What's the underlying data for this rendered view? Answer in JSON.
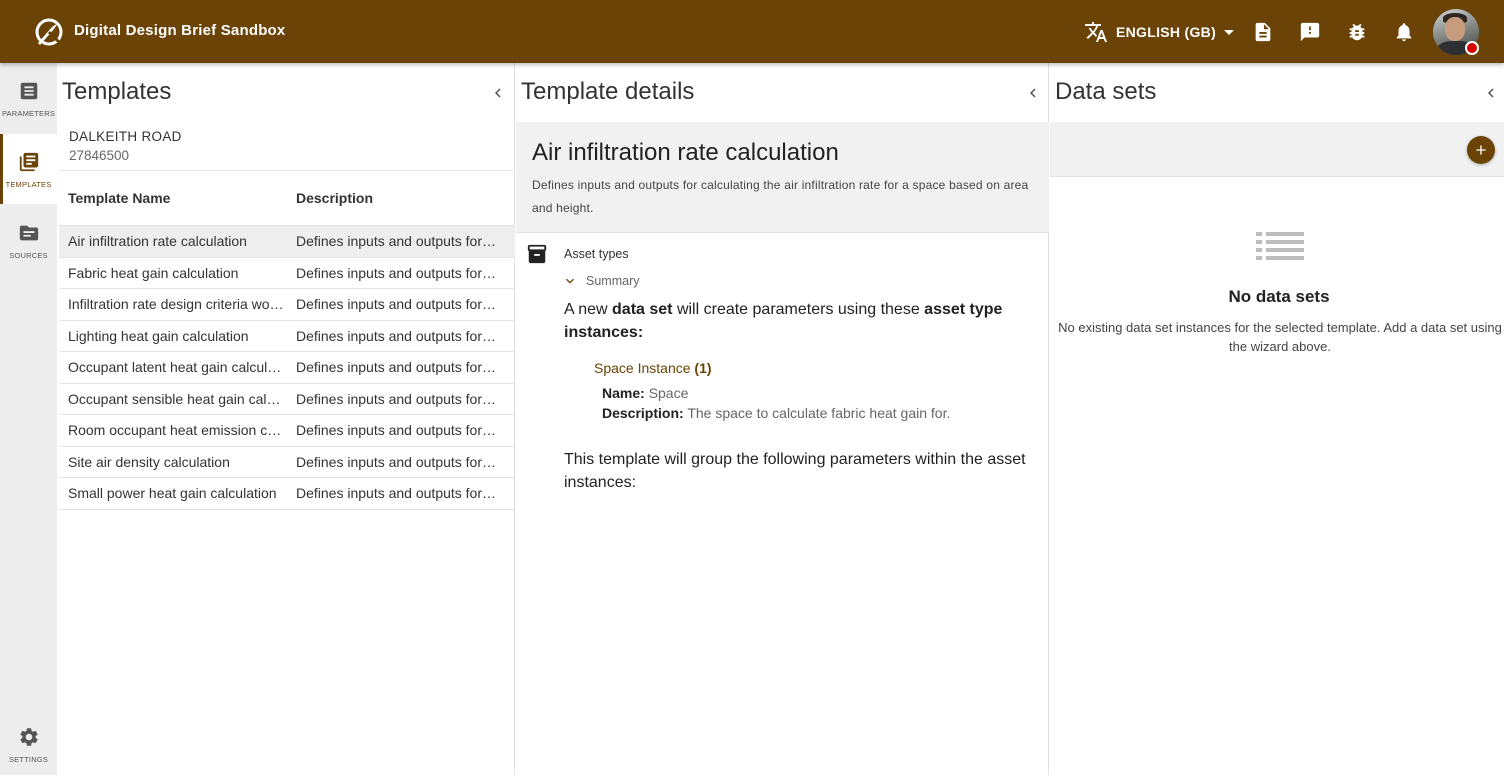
{
  "app": {
    "title": "Digital Design Brief Sandbox",
    "language": "ENGLISH (GB)",
    "accent_color": "#6b4306"
  },
  "toolbar_icons": [
    "translate-icon",
    "document-icon",
    "feedback-icon",
    "bug-icon",
    "bell-icon"
  ],
  "rail": {
    "items": [
      {
        "label": "PARAMETERS",
        "icon": "list-icon"
      },
      {
        "label": "TEMPLATES",
        "icon": "library-icon",
        "active": true
      },
      {
        "label": "SOURCES",
        "icon": "folder-icon"
      },
      {
        "label": "SETTINGS",
        "icon": "gear-icon"
      }
    ]
  },
  "templates": {
    "title": "Templates",
    "project_name": "DALKEITH ROAD",
    "project_number": "27846500",
    "columns": [
      "Template Name",
      "Description"
    ],
    "rows": [
      {
        "name": "Air infiltration rate calculation",
        "description": "Defines inputs and outputs for calculating the air infiltration rate"
      },
      {
        "name": "Fabric heat gain calculation",
        "description": "Defines inputs and outputs for calculating fabric heat gain"
      },
      {
        "name": "Infiltration rate design criteria workflow",
        "description": "Defines inputs and outputs for infiltration rate design criteria"
      },
      {
        "name": "Lighting heat gain calculation",
        "description": "Defines inputs and outputs for calculating lighting heat gain"
      },
      {
        "name": "Occupant latent heat gain calculation",
        "description": "Defines inputs and outputs for calculating occupant latent heat gain"
      },
      {
        "name": "Occupant sensible heat gain calculation",
        "description": "Defines inputs and outputs for calculating occupant sensible heat gain"
      },
      {
        "name": "Room occupant heat emission calculation",
        "description": "Defines inputs and outputs for room occupant heat emission"
      },
      {
        "name": "Site air density calculation",
        "description": "Defines inputs and outputs for calculating site air density"
      },
      {
        "name": "Small power heat gain calculation",
        "description": "Defines inputs and outputs for calculating small power heat gain"
      }
    ]
  },
  "details": {
    "title": "Template details",
    "template_title": "Air infiltration rate calculation",
    "template_description": "Defines inputs and outputs for calculating the air infiltration rate for a space based on area and height.",
    "asset_types_label": "Asset types",
    "summary_label": "Summary",
    "para1_a": "A new ",
    "para1_b": "data set",
    "para1_c": " will create parameters using these ",
    "para1_d": "asset type instances:",
    "instance_name": "Space Instance",
    "instance_count": "(1)",
    "name_key": "Name:",
    "name_value": "Space",
    "desc_key": "Description:",
    "desc_value": "The space to calculate fabric heat gain for.",
    "para2": "This template will group the following parameters within the asset instances:"
  },
  "datasets": {
    "title": "Data sets",
    "empty_title": "No data sets",
    "empty_description": "No existing data set instances for the selected template. Add a data set using the wizard above."
  }
}
